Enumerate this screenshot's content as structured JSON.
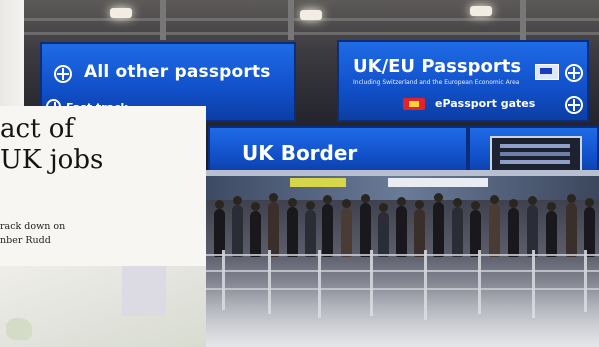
{
  "signs": {
    "all_other": "All other passports",
    "fast_track": "Fast track",
    "uk_eu": "UK/EU Passports",
    "uk_eu_small": "Including Switzerland and the European Economic Area",
    "epassport": "ePassport gates",
    "uk_border": "UK Border"
  },
  "article": {
    "headline": "act of\nUK jobs",
    "standfirst": "rack down on\nnber Rudd"
  },
  "colors": {
    "sign_blue": "#1150c9",
    "paper_bg": "#f7f6f3"
  },
  "icons": [
    "passport-circle-icon",
    "eu-flag-icon",
    "epassport-chip-icon",
    "monitor-screen"
  ]
}
